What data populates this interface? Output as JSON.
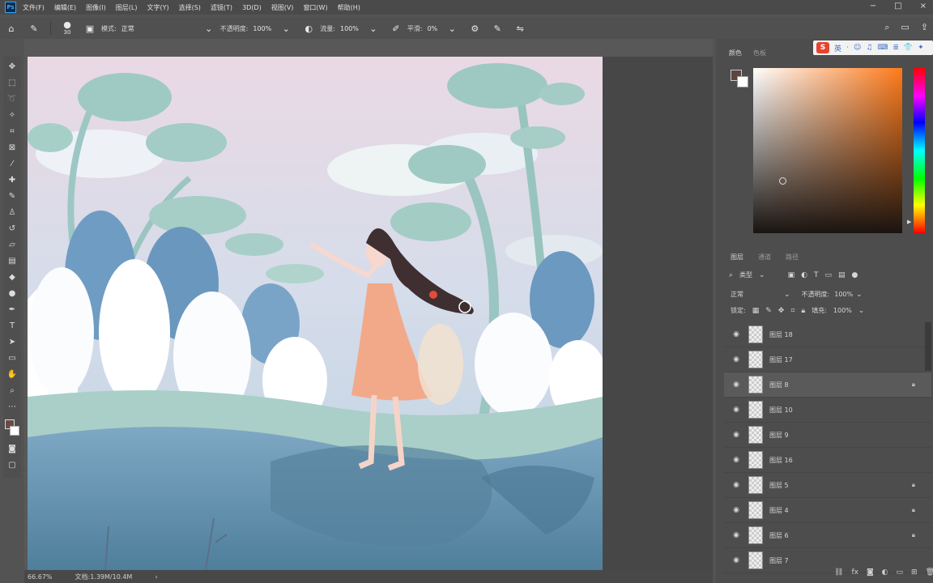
{
  "menubar": {
    "logo": "Ps",
    "items": [
      "文件(F)",
      "编辑(E)",
      "图像(I)",
      "图层(L)",
      "文字(Y)",
      "选择(S)",
      "滤镜(T)",
      "3D(D)",
      "视图(V)",
      "窗口(W)",
      "帮助(H)"
    ],
    "window_controls": [
      "−",
      "□",
      "×"
    ]
  },
  "options": {
    "brush_size": "30",
    "mode_label": "模式:",
    "mode_value": "正常",
    "opacity_label": "不透明度:",
    "opacity_value": "100%",
    "flow_label": "流量:",
    "flow_value": "100%",
    "smooth_label": "平滑:",
    "smooth_value": "0%",
    "right_icons": [
      "search-icon",
      "workspace-icon",
      "share-icon"
    ]
  },
  "tools": [
    "move",
    "marquee",
    "lasso",
    "magic-wand",
    "crop",
    "frame",
    "eyedropper",
    "healing",
    "brush",
    "stamp",
    "history-brush",
    "eraser",
    "gradient",
    "blur",
    "dodge",
    "pen",
    "type",
    "path-select",
    "shape",
    "hand",
    "zoom",
    "more"
  ],
  "colors": {
    "foreground": "#6b4a45",
    "background": "#ffffff",
    "canvas_sky": "#cfe0ea",
    "panel_bg": "#4d4d4d",
    "accent": "#31a8ff"
  },
  "status": {
    "zoom": "66.67%",
    "doc_info": "文档:1.39M/10.4M"
  },
  "ime": {
    "logo": "S",
    "items": [
      "英",
      "·",
      "☺",
      "♫",
      "⌨",
      "≣",
      "👕",
      "✦"
    ]
  },
  "color_panel": {
    "tabs": [
      "颜色",
      "色板"
    ]
  },
  "layers_panel": {
    "tabs": [
      "图层",
      "通道",
      "路径"
    ],
    "filter_label": "类型",
    "blend_mode": "正常",
    "opacity_label": "不透明度:",
    "opacity_value": "100%",
    "lock_label": "锁定:",
    "fill_label": "填充:",
    "fill_value": "100%",
    "layers": [
      {
        "name": "图层 18",
        "locked": false,
        "active": false
      },
      {
        "name": "图层 17",
        "locked": false,
        "active": false
      },
      {
        "name": "图层 8",
        "locked": true,
        "active": true
      },
      {
        "name": "图层 10",
        "locked": false,
        "active": false
      },
      {
        "name": "图层 9",
        "locked": false,
        "active": false
      },
      {
        "name": "图层 16",
        "locked": false,
        "active": false
      },
      {
        "name": "图层 5",
        "locked": true,
        "active": false
      },
      {
        "name": "图层 4",
        "locked": true,
        "active": false
      },
      {
        "name": "图层 6",
        "locked": true,
        "active": false
      },
      {
        "name": "图层 7",
        "locked": false,
        "active": false
      }
    ],
    "footer_icons": [
      "link-icon",
      "fx-icon",
      "mask-icon",
      "adjustment-icon",
      "group-icon",
      "new-layer-icon",
      "trash-icon"
    ]
  }
}
